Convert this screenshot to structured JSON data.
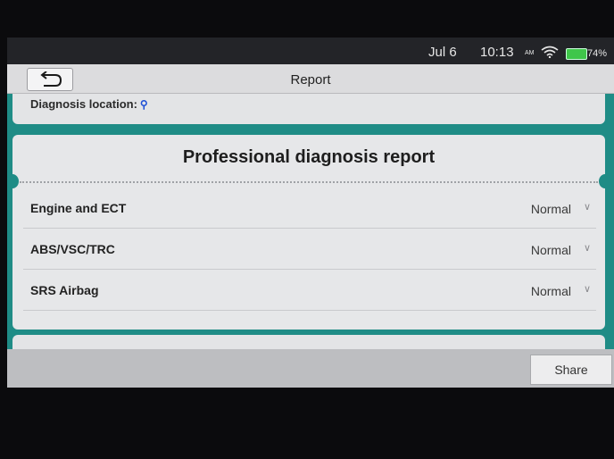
{
  "status_bar": {
    "date": "Jul 6",
    "time": "10:13",
    "ampm": "AM",
    "battery_percent": "74%",
    "battery_level": 0.74,
    "wifi_icon": "wifi-icon",
    "battery_icon": "battery-icon"
  },
  "header": {
    "title": "Report",
    "back_icon": "back-arrow-icon"
  },
  "info": {
    "location_label": "Diagnosis location:",
    "location_icon": "location-pin-icon"
  },
  "report": {
    "title": "Professional diagnosis report",
    "systems": [
      {
        "name": "Engine and ECT",
        "status": "Normal"
      },
      {
        "name": "ABS/VSC/TRC",
        "status": "Normal"
      },
      {
        "name": "SRS Airbag",
        "status": "Normal"
      }
    ]
  },
  "toolbar": {
    "share_label": "Share"
  },
  "colors": {
    "accent": "#1f8c86",
    "card": "#e6e7e9",
    "battery": "#3fc64a"
  }
}
